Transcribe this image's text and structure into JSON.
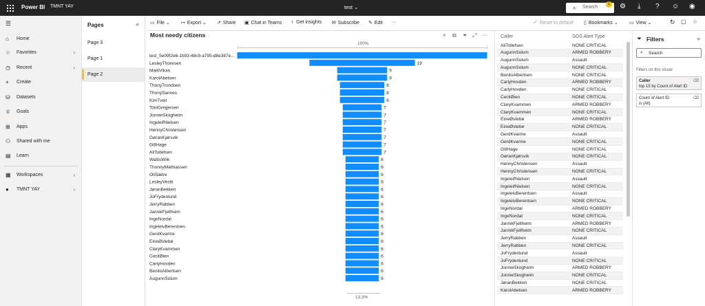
{
  "topbar": {
    "app_name": "Power BI",
    "workspace": "TMNT YAY",
    "report_title": "test",
    "search_placeholder": "Search",
    "notification_count": "1"
  },
  "sidebar": {
    "items": [
      {
        "label": "Home",
        "icon": "home-icon"
      },
      {
        "label": "Favorites",
        "icon": "star-icon",
        "chevron": true
      },
      {
        "label": "Recent",
        "icon": "clock-icon",
        "chevron": true
      },
      {
        "label": "Create",
        "icon": "plus-icon"
      },
      {
        "label": "Datasets",
        "icon": "database-icon"
      },
      {
        "label": "Goals",
        "icon": "trophy-icon"
      },
      {
        "label": "Apps",
        "icon": "apps-icon"
      },
      {
        "label": "Shared with me",
        "icon": "person-share-icon"
      },
      {
        "label": "Learn",
        "icon": "book-icon"
      },
      {
        "label": "Workspaces",
        "icon": "workspaces-icon",
        "chevron": true
      },
      {
        "label": "TMNT YAY",
        "icon": "workspace-avatar-icon",
        "chevron": true
      }
    ]
  },
  "pages_panel": {
    "heading": "Pages",
    "pages": [
      "Page 3",
      "Page 1",
      "Page 2"
    ],
    "active_index": 2
  },
  "toolbar": {
    "file": "File",
    "export": "Export",
    "share": "Share",
    "chat_in_teams": "Chat in Teams",
    "get_insights": "Get insights",
    "subscribe": "Subscribe",
    "edit": "Edit",
    "more": "···",
    "reset_to_default": "Reset to default",
    "bookmarks": "Bookmarks",
    "view": "View"
  },
  "visual": {
    "title": "Most needy citizens",
    "top_percent_label": "100%",
    "bottom_percent_label": "13.3%"
  },
  "chart_data": {
    "type": "bar",
    "orientation": "horizontal",
    "title": "Most needy citizens",
    "layout": "funnel",
    "categories": [
      "test_5e09f2e6-1b93-48c9-a795-d8e387e...",
      "LesleyThoresen",
      "MattiVikan",
      "KarolAbelsen",
      "ThonyTrondsen",
      "ThonySannes",
      "KimTveit",
      "ToniGregersen",
      "JonnieSkogheim",
      "IngeleifNielsen",
      "HennyChristensen",
      "GøranKjørsvik",
      "GillHage",
      "AliTollefsen",
      "WallisWiik",
      "ThonnyMathiassen",
      "OliSætre",
      "LesleyVestli",
      "JøranBekken",
      "JoFrydenlund",
      "JerryRabben",
      "JannikFjellheim",
      "IngeNordal",
      "IngeleivBerentsen",
      "GerdKvarme",
      "EineØstebø",
      "ClaryKvammen",
      "CecilØien",
      "CarlyHovden",
      "BenitoAlbertsen",
      "AugunnSolum"
    ],
    "values": [
      45,
      19,
      9,
      9,
      8,
      8,
      8,
      7,
      7,
      7,
      7,
      7,
      7,
      7,
      6,
      6,
      6,
      6,
      6,
      6,
      6,
      6,
      6,
      6,
      6,
      6,
      6,
      6,
      6,
      6,
      6
    ],
    "value_labels_shown": [
      false,
      true,
      true,
      true,
      true,
      true,
      true,
      true,
      true,
      true,
      true,
      true,
      true,
      true,
      true,
      true,
      true,
      true,
      true,
      true,
      true,
      true,
      true,
      true,
      true,
      true,
      true,
      true,
      true,
      true,
      true
    ],
    "bar_color": "#118DFF"
  },
  "table": {
    "columns": [
      "Caller",
      "SOS Alert Type"
    ],
    "rows": [
      [
        "AliTollefsen",
        "NONE CRITICAL"
      ],
      [
        "AugunnSolum",
        "ARMED ROBBERY"
      ],
      [
        "AugunnSolum",
        "Assault"
      ],
      [
        "AugunnSolum",
        "NONE CRITICAL"
      ],
      [
        "BenitoAlbertsen",
        "NONE CRITICAL"
      ],
      [
        "CarlyHovden",
        "ARMED ROBBERY"
      ],
      [
        "CarlyHovden",
        "NONE CRITICAL"
      ],
      [
        "CecilØien",
        "NONE CRITICAL"
      ],
      [
        "ClaryKvammen",
        "ARMED ROBBERY"
      ],
      [
        "ClaryKvammen",
        "NONE CRITICAL"
      ],
      [
        "EineØstebø",
        "ARMED ROBBERY"
      ],
      [
        "EineØstebø",
        "NONE CRITICAL"
      ],
      [
        "GerdKvarme",
        "Assault"
      ],
      [
        "GerdKvarme",
        "NONE CRITICAL"
      ],
      [
        "GillHage",
        "NONE CRITICAL"
      ],
      [
        "GøranKjørsvik",
        "NONE CRITICAL"
      ],
      [
        "HennyChristensen",
        "Assault"
      ],
      [
        "HennyChristensen",
        "NONE CRITICAL"
      ],
      [
        "IngeleifNielsen",
        "Assault"
      ],
      [
        "IngeleifNielsen",
        "NONE CRITICAL"
      ],
      [
        "IngeleivBerentsen",
        "Assault"
      ],
      [
        "IngeleivBerentsen",
        "NONE CRITICAL"
      ],
      [
        "IngeNordal",
        "ARMED ROBBERY"
      ],
      [
        "IngeNordal",
        "NONE CRITICAL"
      ],
      [
        "JannikFjellheim",
        "ARMED ROBBERY"
      ],
      [
        "JannikFjellheim",
        "NONE CRITICAL"
      ],
      [
        "JerryRabben",
        "Assault"
      ],
      [
        "JerryRabben",
        "NONE CRITICAL"
      ],
      [
        "JoFrydenlund",
        "Assault"
      ],
      [
        "JoFrydenlund",
        "NONE CRITICAL"
      ],
      [
        "JonnieSkogheim",
        "ARMED ROBBERY"
      ],
      [
        "JonnieSkogheim",
        "NONE CRITICAL"
      ],
      [
        "JøranBekken",
        "NONE CRITICAL"
      ],
      [
        "KarolAbelsen",
        "ARMED ROBBERY"
      ]
    ]
  },
  "filters": {
    "title": "Filters",
    "search_placeholder": "Search",
    "section_label": "Filters on this visual",
    "cards": [
      {
        "title": "Caller",
        "subtitle": "top 15 by Count of Alert ID"
      },
      {
        "title": "Count of Alert ID",
        "subtitle": "is (All)"
      }
    ]
  },
  "colors": {
    "topbar_bg": "#252423",
    "accent_yellow": "#F2C811",
    "bar_blue": "#118DFF"
  }
}
